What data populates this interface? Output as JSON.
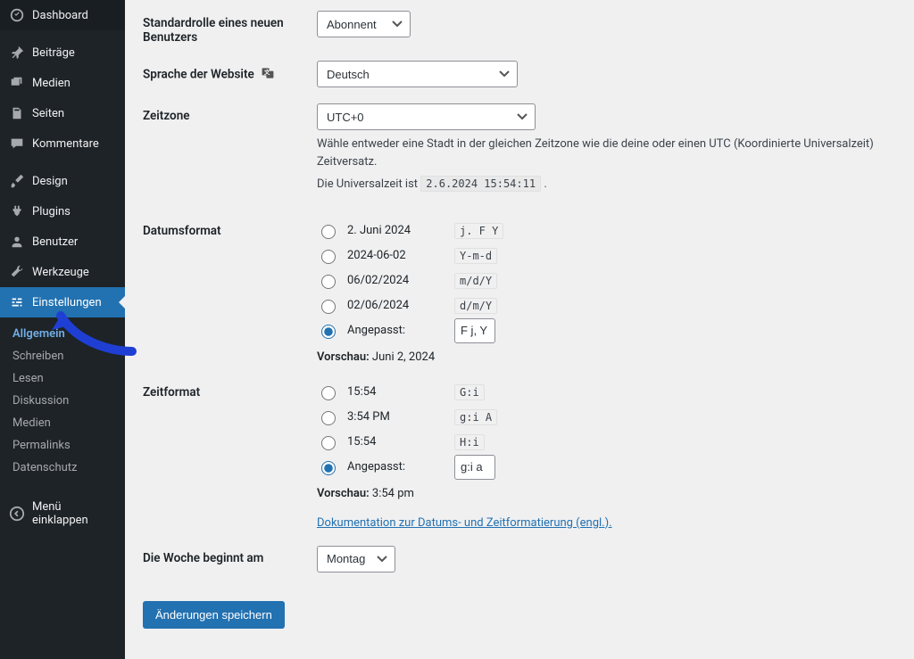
{
  "sidebar": {
    "dashboard": "Dashboard",
    "posts": "Beiträge",
    "media": "Medien",
    "pages": "Seiten",
    "comments": "Kommentare",
    "design": "Design",
    "plugins": "Plugins",
    "users": "Benutzer",
    "tools": "Werkzeuge",
    "settings": "Einstellungen",
    "collapse": "Menü einklappen",
    "submenu": {
      "general": "Allgemein",
      "writing": "Schreiben",
      "reading": "Lesen",
      "discussion": "Diskussion",
      "media": "Medien",
      "permalinks": "Permalinks",
      "privacy": "Datenschutz"
    }
  },
  "form": {
    "default_role_label": "Standardrolle eines neuen Benutzers",
    "default_role_value": "Abonnent",
    "site_language_label": "Sprache der Website",
    "site_language_value": "Deutsch",
    "timezone_label": "Zeitzone",
    "timezone_value": "UTC+0",
    "timezone_help": "Wähle entweder eine Stadt in der gleichen Zeitzone wie die deine oder einen UTC (Koordinierte Universalzeit) Zeitversatz.",
    "utc_prefix": "Die Universalzeit ist ",
    "utc_value": "2.6.2024 15:54:11",
    "utc_suffix": " .",
    "date_format_label": "Datumsformat",
    "date_options": [
      {
        "label": "2. Juni 2024",
        "format": "j. F Y"
      },
      {
        "label": "2024-06-02",
        "format": "Y-m-d"
      },
      {
        "label": "06/02/2024",
        "format": "m/d/Y"
      },
      {
        "label": "02/06/2024",
        "format": "d/m/Y"
      }
    ],
    "date_custom_label": "Angepasst:",
    "date_custom_value": "F j, Y",
    "date_preview_label": "Vorschau:",
    "date_preview_value": "Juni 2, 2024",
    "time_format_label": "Zeitformat",
    "time_options": [
      {
        "label": "15:54",
        "format": "G:i"
      },
      {
        "label": "3:54 PM",
        "format": "g:i A"
      },
      {
        "label": "15:54",
        "format": "H:i"
      }
    ],
    "time_custom_label": "Angepasst:",
    "time_custom_value": "g:i a",
    "time_preview_label": "Vorschau:",
    "time_preview_value": "3:54 pm",
    "doc_link": "Dokumentation zur Datums- und Zeitformatierung (engl.).",
    "week_start_label": "Die Woche beginnt am",
    "week_start_value": "Montag",
    "save_button": "Änderungen speichern"
  }
}
